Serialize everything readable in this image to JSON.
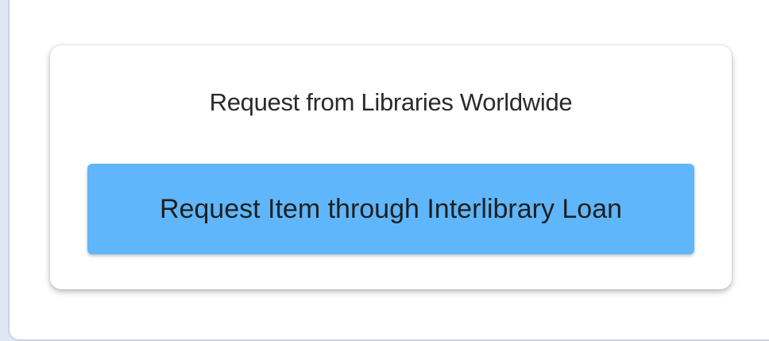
{
  "card": {
    "heading": "Request from Libraries Worldwide",
    "button_label": "Request Item through Interlibrary Loan"
  },
  "colors": {
    "page_background": "#dfe7f4",
    "button_background": "#5fb6fb",
    "text": "#2b2b2b"
  }
}
